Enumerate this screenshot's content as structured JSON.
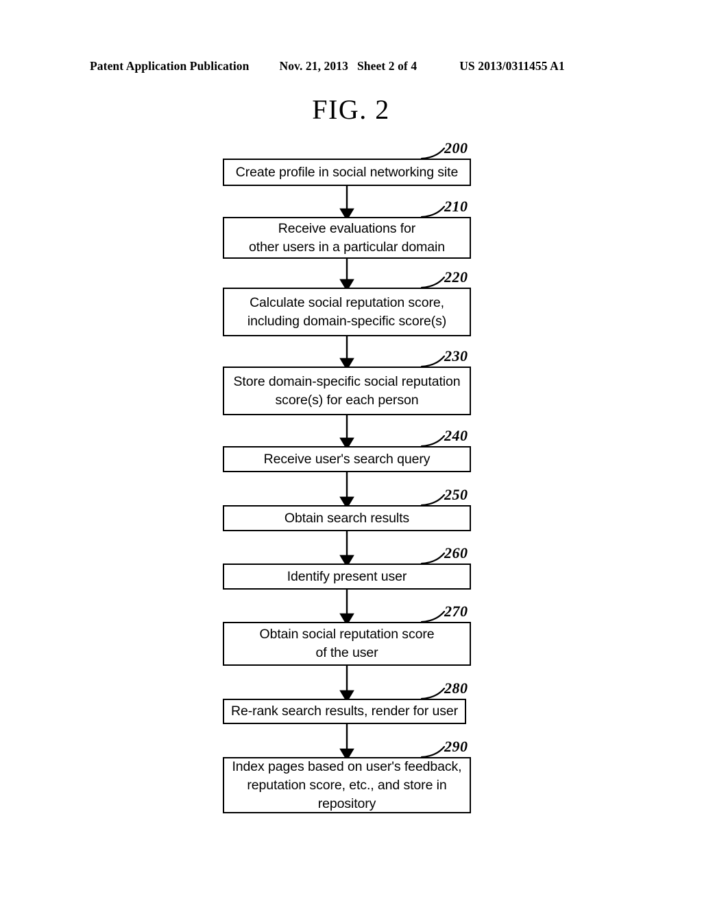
{
  "header": {
    "publication": "Patent Application Publication",
    "date": "Nov. 21, 2013",
    "sheet": "Sheet 2 of 4",
    "doc_number": "US 2013/0311455 A1"
  },
  "figure": {
    "title": "FIG. 2"
  },
  "chart_data": {
    "type": "diagram",
    "diagram_type": "flowchart",
    "orientation": "top-to-bottom",
    "title": "FIG. 2",
    "nodes": [
      {
        "ref": "200",
        "lines": [
          "Create profile in social networking site"
        ]
      },
      {
        "ref": "210",
        "lines": [
          "Receive evaluations for",
          "other users in a particular domain"
        ]
      },
      {
        "ref": "220",
        "lines": [
          "Calculate social reputation score,",
          "including domain-specific score(s)"
        ]
      },
      {
        "ref": "230",
        "lines": [
          "Store domain-specific social reputation",
          "score(s) for each person"
        ]
      },
      {
        "ref": "240",
        "lines": [
          "Receive user's search query"
        ]
      },
      {
        "ref": "250",
        "lines": [
          "Obtain search results"
        ]
      },
      {
        "ref": "260",
        "lines": [
          "Identify present user"
        ]
      },
      {
        "ref": "270",
        "lines": [
          "Obtain social reputation score",
          "of the user"
        ]
      },
      {
        "ref": "280",
        "lines": [
          "Re-rank search results, render for user"
        ]
      },
      {
        "ref": "290",
        "lines": [
          "Index pages based on user's feedback,",
          "reputation score, etc., and store in",
          "repository"
        ]
      }
    ],
    "edges": [
      {
        "from": "200",
        "to": "210"
      },
      {
        "from": "210",
        "to": "220"
      },
      {
        "from": "220",
        "to": "230"
      },
      {
        "from": "230",
        "to": "240"
      },
      {
        "from": "240",
        "to": "250"
      },
      {
        "from": "250",
        "to": "260"
      },
      {
        "from": "260",
        "to": "270"
      },
      {
        "from": "270",
        "to": "280"
      },
      {
        "from": "280",
        "to": "290"
      }
    ],
    "colors": {
      "line": "#000000",
      "fill": "#ffffff",
      "text": "#000000"
    }
  },
  "nodes": {
    "n200": {
      "ref": "200",
      "l0": "Create profile in social networking site"
    },
    "n210": {
      "ref": "210",
      "l0": "Receive evaluations for",
      "l1": "other users in a particular domain"
    },
    "n220": {
      "ref": "220",
      "l0": "Calculate social reputation score,",
      "l1": "including domain-specific score(s)"
    },
    "n230": {
      "ref": "230",
      "l0": "Store domain-specific social reputation",
      "l1": "score(s) for each person"
    },
    "n240": {
      "ref": "240",
      "l0": "Receive user's search query"
    },
    "n250": {
      "ref": "250",
      "l0": "Obtain search results"
    },
    "n260": {
      "ref": "260",
      "l0": "Identify present user"
    },
    "n270": {
      "ref": "270",
      "l0": "Obtain social reputation score",
      "l1": "of the user"
    },
    "n280": {
      "ref": "280",
      "l0": "Re-rank search results, render for user"
    },
    "n290": {
      "ref": "290",
      "l0": "Index pages based on user's feedback,",
      "l1": "reputation score, etc., and store in",
      "l2": "repository"
    }
  }
}
